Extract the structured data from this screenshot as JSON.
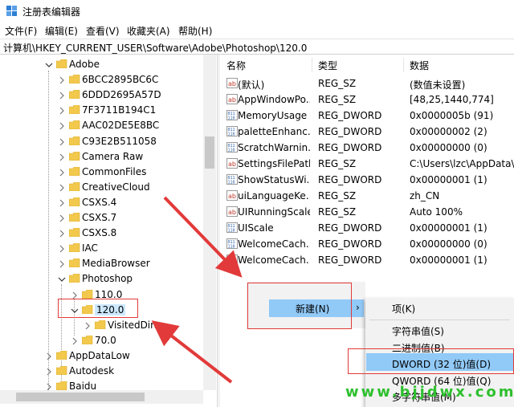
{
  "window": {
    "title": "注册表编辑器"
  },
  "menu": [
    "文件(F)",
    "编辑(E)",
    "查看(V)",
    "收藏夹(A)",
    "帮助(H)"
  ],
  "address": "计算机\\HKEY_CURRENT_USER\\Software\\Adobe\\Photoshop\\120.0",
  "tree": [
    {
      "label": "Adobe",
      "expanded": true
    },
    {
      "label": "6BCC2895BC6C"
    },
    {
      "label": "6DDD2695A57D"
    },
    {
      "label": "7F3711B194C1"
    },
    {
      "label": "AAC02DE5E8BC"
    },
    {
      "label": "C93E2B511058"
    },
    {
      "label": "Camera Raw"
    },
    {
      "label": "CommonFiles"
    },
    {
      "label": "CreativeCloud"
    },
    {
      "label": "CSXS.4"
    },
    {
      "label": "CSXS.7"
    },
    {
      "label": "CSXS.8"
    },
    {
      "label": "IAC"
    },
    {
      "label": "MediaBrowser"
    },
    {
      "label": "Photoshop",
      "expanded": true
    },
    {
      "label": "110.0"
    },
    {
      "label": "120.0",
      "expanded": true,
      "selected": true
    },
    {
      "label": "VisitedDirs"
    },
    {
      "label": "70.0"
    },
    {
      "label": "AppDataLow"
    },
    {
      "label": "Autodesk"
    },
    {
      "label": "Baidu"
    }
  ],
  "list": {
    "headers": [
      "名称",
      "类型",
      "数据"
    ],
    "rows": [
      {
        "name": "(默认)",
        "type": "REG_SZ",
        "data": "(数值未设置)",
        "icon": "string-value-icon"
      },
      {
        "name": "AppWindowPo...",
        "type": "REG_SZ",
        "data": "[48,25,1440,774]",
        "icon": "string-value-icon"
      },
      {
        "name": "MemoryUsage",
        "type": "REG_DWORD",
        "data": "0x0000005b (91)",
        "icon": "binary-value-icon"
      },
      {
        "name": "paletteEnhanc...",
        "type": "REG_DWORD",
        "data": "0x00000002 (2)",
        "icon": "binary-value-icon"
      },
      {
        "name": "ScratchWarnin...",
        "type": "REG_DWORD",
        "data": "0x00000000 (0)",
        "icon": "binary-value-icon"
      },
      {
        "name": "SettingsFilePath",
        "type": "REG_SZ",
        "data": "C:\\Users\\lzc\\AppData\\R",
        "icon": "string-value-icon"
      },
      {
        "name": "ShowStatusWi...",
        "type": "REG_DWORD",
        "data": "0x00000001 (1)",
        "icon": "binary-value-icon"
      },
      {
        "name": "uiLanguageKe...",
        "type": "REG_SZ",
        "data": "zh_CN",
        "icon": "string-value-icon"
      },
      {
        "name": "UIRunningScale",
        "type": "REG_SZ",
        "data": "Auto 100%",
        "icon": "string-value-icon"
      },
      {
        "name": "UIScale",
        "type": "REG_DWORD",
        "data": "0x00000001 (1)",
        "icon": "binary-value-icon"
      },
      {
        "name": "WelcomeCach...",
        "type": "REG_DWORD",
        "data": "0x00000000 (0)",
        "icon": "binary-value-icon"
      },
      {
        "name": "WelcomeCach...",
        "type": "REG_DWORD",
        "data": "0x00000001 (1)",
        "icon": "binary-value-icon"
      }
    ]
  },
  "context_menu": {
    "new_label": "新建(N)",
    "submenu": [
      "项(K)",
      "字符串值(S)",
      "二进制值(B)",
      "DWORD (32 位)值(D)",
      "QWORD (64 位)值(Q)",
      "多字符串值(M)"
    ]
  },
  "watermark": "www.bjjdwx.com",
  "colors": {
    "folder": "#f2c94c",
    "highlight": "#91c9f7",
    "annotation": "#e23a3a",
    "watermark": "#2ec02e"
  }
}
